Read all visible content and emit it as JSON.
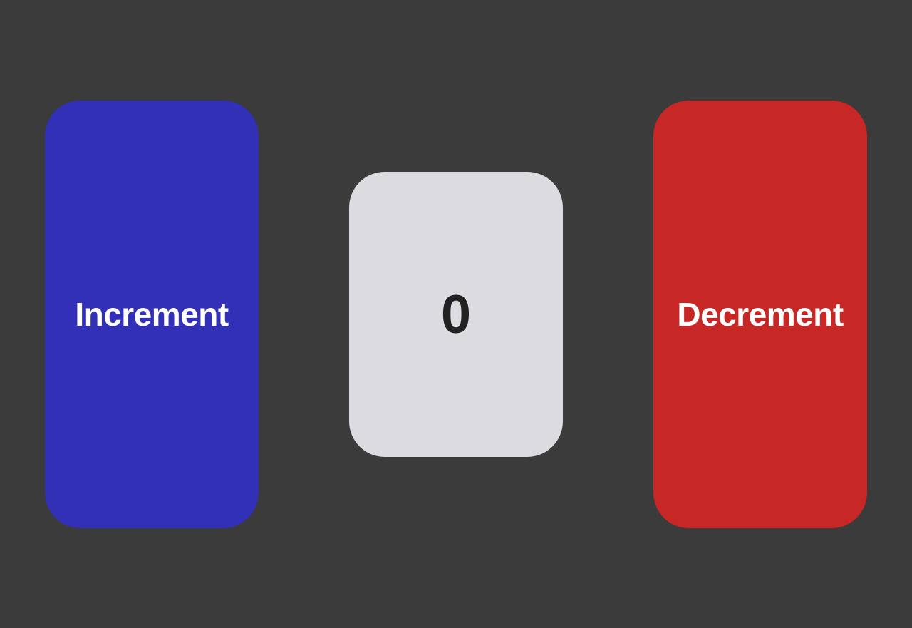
{
  "buttons": {
    "increment_label": "Increment",
    "decrement_label": "Decrement"
  },
  "counter": {
    "value": "0"
  },
  "colors": {
    "background": "#3b3b3b",
    "increment": "#3330b8",
    "decrement": "#c72826",
    "counter_bg": "#dcdbdf",
    "counter_text": "#222222"
  }
}
